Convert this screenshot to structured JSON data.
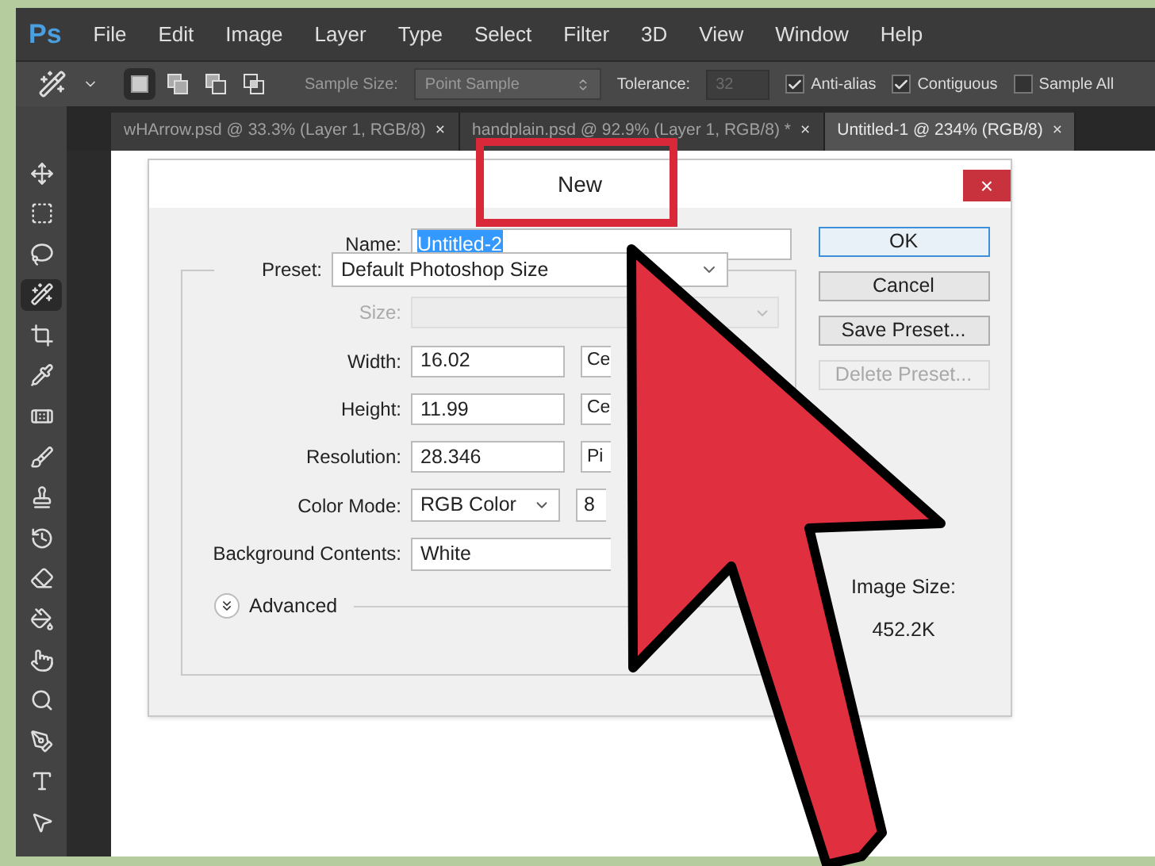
{
  "app": {
    "logo": "Ps"
  },
  "menu": [
    "File",
    "Edit",
    "Image",
    "Layer",
    "Type",
    "Select",
    "Filter",
    "3D",
    "View",
    "Window",
    "Help"
  ],
  "options_bar": {
    "modes": [
      {
        "selected": true
      },
      {
        "selected": false
      },
      {
        "selected": false
      },
      {
        "selected": false
      }
    ],
    "sample_size_label": "Sample Size:",
    "sample_size_value": "Point Sample",
    "tolerance_label": "Tolerance:",
    "tolerance_value": "32",
    "checkboxes": [
      {
        "label": "Anti-alias",
        "checked": true
      },
      {
        "label": "Contiguous",
        "checked": true
      },
      {
        "label": "Sample All",
        "checked": false
      }
    ]
  },
  "tabs": [
    {
      "label": "wHArrow.psd @ 33.3% (Layer 1, RGB/8)",
      "close": "×",
      "selected": false
    },
    {
      "label": "handplain.psd @ 92.9% (Layer 1, RGB/8) *",
      "close": "×",
      "selected": false
    },
    {
      "label": "Untitled-1 @ 234% (RGB/8)",
      "close": "×",
      "selected": true
    }
  ],
  "tools": [
    {
      "kind": "move",
      "selected": false
    },
    {
      "kind": "marquee",
      "selected": false
    },
    {
      "kind": "lasso",
      "selected": false
    },
    {
      "kind": "wand",
      "selected": true
    },
    {
      "kind": "crop",
      "selected": false
    },
    {
      "kind": "eyedropper",
      "selected": false
    },
    {
      "kind": "healing",
      "selected": false
    },
    {
      "kind": "brush",
      "selected": false
    },
    {
      "kind": "stamp",
      "selected": false
    },
    {
      "kind": "history",
      "selected": false
    },
    {
      "kind": "eraser",
      "selected": false
    },
    {
      "kind": "bucket",
      "selected": false
    },
    {
      "kind": "smudge",
      "selected": false
    },
    {
      "kind": "dodge",
      "selected": false
    },
    {
      "kind": "pen",
      "selected": false
    },
    {
      "kind": "type",
      "selected": false
    },
    {
      "kind": "select",
      "selected": false
    }
  ],
  "dialog": {
    "title": "New",
    "close": "×",
    "name_label": "Name:",
    "name_value": "Untitled-2",
    "preset_label": "Preset:",
    "preset_value": "Default Photoshop Size",
    "rows": [
      {
        "kind": "size",
        "label": "Size:",
        "disabled": true
      },
      {
        "kind": "unit",
        "label": "Width:",
        "value": "16.02",
        "unit": "Ce"
      },
      {
        "kind": "unit",
        "label": "Height:",
        "value": "11.99",
        "unit": "Ce"
      },
      {
        "kind": "unit",
        "label": "Resolution:",
        "value": "28.346",
        "unit": "Pi"
      },
      {
        "kind": "mode",
        "label": "Color Mode:",
        "value": "RGB Color",
        "unit": "8"
      },
      {
        "kind": "wide",
        "label": "Background Contents:",
        "value": "White"
      }
    ],
    "advanced": "Advanced",
    "buttons": [
      {
        "label": "OK",
        "default": true,
        "disabled": false
      },
      {
        "label": "Cancel",
        "default": false,
        "disabled": false
      },
      {
        "label": "Save Preset...",
        "default": false,
        "disabled": false
      },
      {
        "label": "Delete Preset...",
        "default": false,
        "disabled": true
      }
    ],
    "image_size_label": "Image Size:",
    "image_size_value": "452.2K"
  }
}
